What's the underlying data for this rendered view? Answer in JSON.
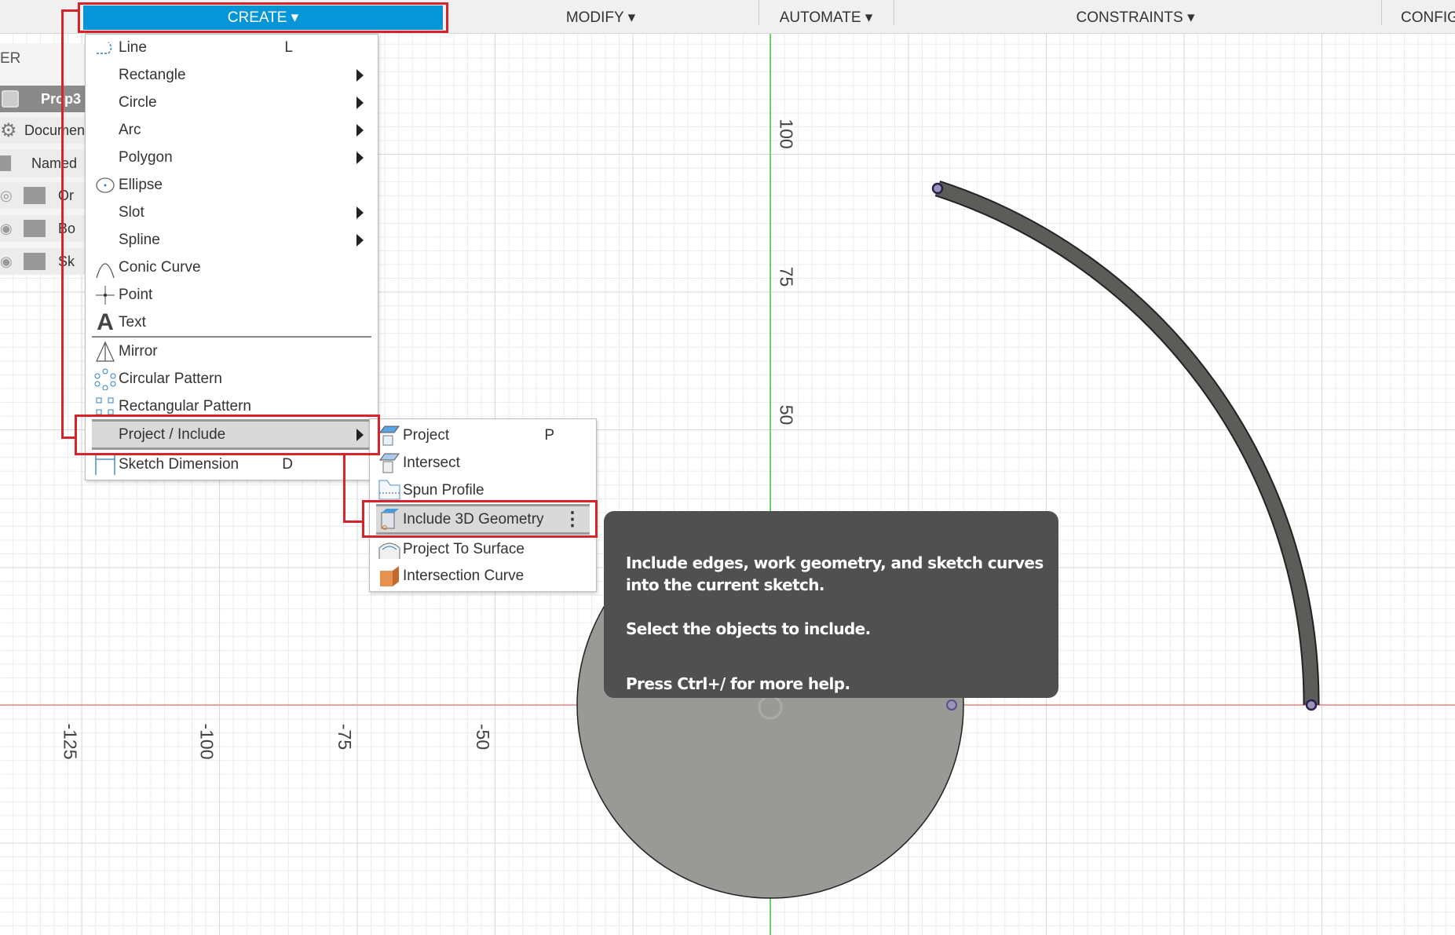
{
  "toolbar": {
    "tabs": [
      {
        "label": "CREATE ▾",
        "active": true
      },
      {
        "label": "MODIFY ▾"
      },
      {
        "label": "AUTOMATE ▾"
      },
      {
        "label": "CONSTRAINTS ▾"
      },
      {
        "label": "CONFIG"
      }
    ]
  },
  "browser": {
    "header": "ER",
    "rows": [
      "Prop3",
      "Documen",
      "Named",
      "Or",
      "Bo",
      "Sk"
    ]
  },
  "create_menu": {
    "items": [
      {
        "label": "Line",
        "shortcut": "L",
        "icon": "line-icon"
      },
      {
        "label": "Rectangle",
        "submenu": true
      },
      {
        "label": "Circle",
        "submenu": true
      },
      {
        "label": "Arc",
        "submenu": true
      },
      {
        "label": "Polygon",
        "submenu": true
      },
      {
        "label": "Ellipse",
        "icon": "ellipse-icon"
      },
      {
        "label": "Slot",
        "submenu": true
      },
      {
        "label": "Spline",
        "submenu": true
      },
      {
        "label": "Conic Curve",
        "icon": "conic-curve-icon"
      },
      {
        "label": "Point",
        "icon": "point-icon"
      },
      {
        "label": "Text",
        "icon": "text-icon"
      },
      {
        "label": "Mirror",
        "icon": "mirror-icon"
      },
      {
        "label": "Circular Pattern",
        "icon": "circular-pattern-icon"
      },
      {
        "label": "Rectangular Pattern",
        "icon": "rectangular-pattern-icon"
      },
      {
        "label": "Project / Include",
        "submenu": true,
        "highlighted": true
      },
      {
        "label": "Sketch Dimension",
        "shortcut": "D",
        "icon": "sketch-dimension-icon"
      }
    ]
  },
  "sub_menu": {
    "items": [
      {
        "label": "Project",
        "shortcut": "P",
        "icon": "project-icon"
      },
      {
        "label": "Intersect",
        "icon": "intersect-icon"
      },
      {
        "label": "Spun Profile",
        "icon": "spun-profile-icon"
      },
      {
        "label": "Include 3D Geometry",
        "icon": "include-3d-geometry-icon",
        "highlighted": true
      },
      {
        "label": "Project To Surface",
        "icon": "project-to-surface-icon"
      },
      {
        "label": "Intersection Curve",
        "icon": "intersection-curve-icon"
      }
    ]
  },
  "tooltip": {
    "line1": "Include edges, work geometry, and sketch curves",
    "line2": "into the current sketch.",
    "line3": "Select the objects to include.",
    "line4": "Press Ctrl+/ for more help."
  },
  "axes": {
    "x_labels": [
      "-125",
      "-100",
      "-75",
      "-50"
    ],
    "y_labels": [
      "100",
      "75",
      "50"
    ]
  },
  "colors": {
    "accent": "#0696d7",
    "highlight_box": "#d9232a",
    "tooltip_bg": "#505050",
    "x_axis": "#e06060",
    "y_axis": "#3cc83c"
  }
}
